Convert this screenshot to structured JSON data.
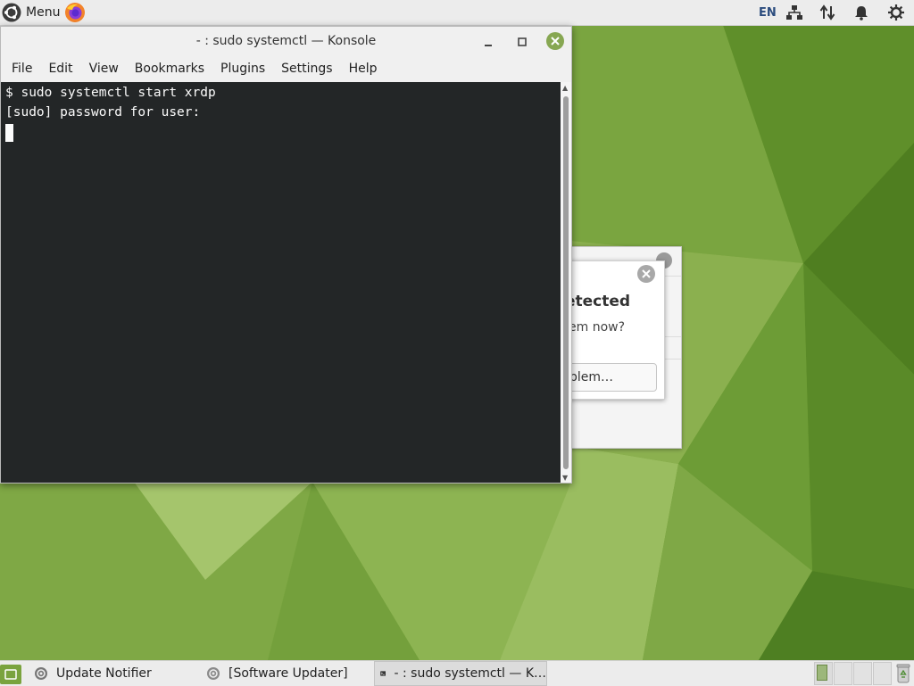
{
  "top_panel": {
    "menu_label": "Menu",
    "language": "EN"
  },
  "konsole": {
    "title": "- : sudo systemctl — Konsole",
    "menu": [
      "File",
      "Edit",
      "View",
      "Bookmarks",
      "Plugins",
      "Settings",
      "Help"
    ],
    "terminal_lines": [
      "$ sudo systemctl start xrdp",
      "[sudo] password for user:"
    ]
  },
  "background_dialog": {
    "title_fragment": "etected",
    "question_fragment": "em now?",
    "button_fragment": "blem…"
  },
  "taskbar": {
    "tasks": [
      {
        "label": "Update Notifier"
      },
      {
        "label": "[Software Updater]"
      },
      {
        "label": "- : sudo systemctl — K…"
      }
    ]
  },
  "colors": {
    "wallpaper_green": "#6f9a2f",
    "accent_green": "#87a752",
    "terminal_bg": "#232627"
  },
  "icons": [
    "ubuntu-logo-icon",
    "firefox-icon",
    "network-icon",
    "updown-arrows-icon",
    "bell-icon",
    "power-icon",
    "close-icon",
    "minimize-icon",
    "maximize-icon",
    "terminal-icon",
    "updater-icon",
    "trash-icon"
  ]
}
